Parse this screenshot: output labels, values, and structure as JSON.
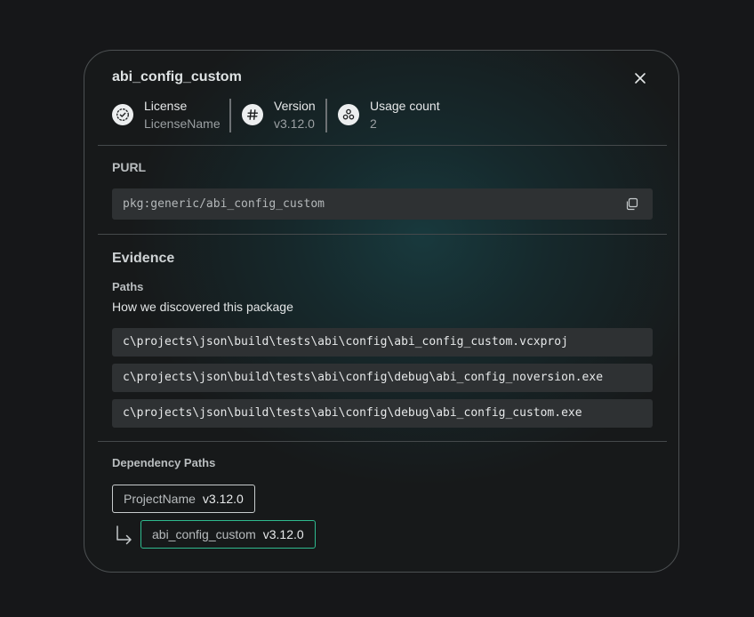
{
  "modal": {
    "title": "abi_config_custom",
    "close_icon": "close-icon"
  },
  "meta": [
    {
      "label": "License",
      "value": "LicenseName",
      "icon": "license-check-icon"
    },
    {
      "label": "Version",
      "value": "v3.12.0",
      "icon": "hash-icon"
    },
    {
      "label": "Usage count",
      "value": "2",
      "icon": "usage-nodes-icon"
    }
  ],
  "purl": {
    "label": "PURL",
    "value": "pkg:generic/abi_config_custom",
    "copy_icon": "copy-icon"
  },
  "evidence": {
    "heading": "Evidence",
    "paths_label": "Paths",
    "paths_description": "How we discovered this package",
    "paths": [
      "c\\projects\\json\\build\\tests\\abi\\config\\abi_config_custom.vcxproj",
      "c\\projects\\json\\build\\tests\\abi\\config\\debug\\abi_config_noversion.exe",
      "c\\projects\\json\\build\\tests\\abi\\config\\debug\\abi_config_custom.exe"
    ]
  },
  "dependency_paths": {
    "label": "Dependency Paths",
    "nodes": [
      {
        "name": "ProjectName",
        "version": "v3.12.0"
      },
      {
        "name": "abi_config_custom",
        "version": "v3.12.0"
      }
    ],
    "connector_icon": "arrow-down-right-icon"
  },
  "colors": {
    "accent_green": "#2fbb8f",
    "panel_border": "#4c5052",
    "code_bg": "#2e3133"
  }
}
